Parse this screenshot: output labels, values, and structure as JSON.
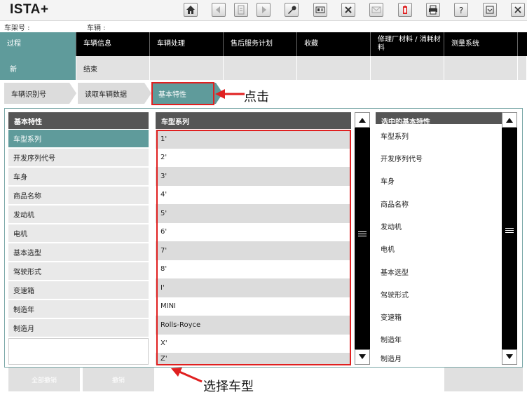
{
  "app": {
    "title": "ISTA+"
  },
  "info": {
    "chassis_label": "车架号 :",
    "vehicle_label": "车辆 :"
  },
  "main_nav": [
    {
      "label": "过程",
      "active": true
    },
    {
      "label": "车辆信息"
    },
    {
      "label": "车辆处理"
    },
    {
      "label": "售后服务计划"
    },
    {
      "label": "收藏"
    },
    {
      "label": "修理厂材料 / 消耗材料"
    },
    {
      "label": "测量系统"
    }
  ],
  "sub_nav": [
    {
      "label": "新",
      "active": true
    },
    {
      "label": "结束"
    }
  ],
  "steps": [
    {
      "label": "车辆识别号"
    },
    {
      "label": "读取车辆数据"
    },
    {
      "label": "基本特性",
      "active": true
    }
  ],
  "annotations": {
    "click": "点击",
    "select_model": "选择车型"
  },
  "left_panel": {
    "header": "基本特性",
    "items": [
      "车型系列",
      "开发序列代号",
      "车身",
      "商品名称",
      "发动机",
      "电机",
      "基本选型",
      "驾驶形式",
      "变速箱",
      "制造年",
      "制造月"
    ],
    "selected_index": 0
  },
  "middle_panel": {
    "header": "车型系列",
    "rows": [
      "1'",
      "2'",
      "3'",
      "4'",
      "5'",
      "6'",
      "7'",
      "8'",
      "I'",
      "MINI",
      "Rolls-Royce",
      "X'",
      "Z'"
    ]
  },
  "right_panel": {
    "header": "选中的基本特性",
    "items": [
      "车型系列",
      "开发序列代号",
      "车身",
      "商品名称",
      "发动机",
      "电机",
      "基本选型",
      "驾驶形式",
      "变速箱",
      "制造年",
      "制造月"
    ]
  },
  "buttons": {
    "undo_all": "全部撤销",
    "undo": "撤销"
  },
  "toolbar_icons": [
    "home-icon",
    "back-icon",
    "document-icon",
    "forward-icon",
    "wrench-icon",
    "id-card-icon",
    "tools-icon",
    "mail-icon",
    "battery-icon",
    "printer-icon",
    "help-icon",
    "minimize-icon",
    "close-icon"
  ],
  "colors": {
    "accent": "#5f9b9b",
    "highlight_red": "#e02020",
    "nav_bg": "#000000"
  }
}
